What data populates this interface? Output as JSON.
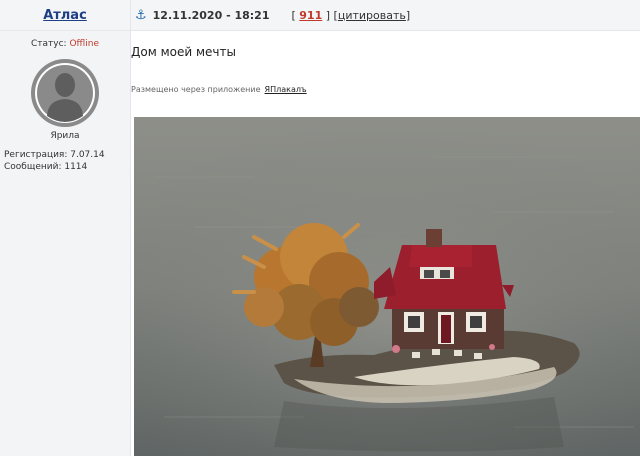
{
  "author": {
    "name": "Атлас"
  },
  "status": {
    "label": "Статус:",
    "value": "Offline"
  },
  "rank": "Ярила",
  "registration": "Регистрация: 7.07.14",
  "posts_count": "Сообщений: 1114",
  "post": {
    "anchor_icon": "anchor-icon",
    "datetime": "12.11.2020 - 18:21",
    "rating_open": "[",
    "rating": "911",
    "rating_close": "]",
    "quote_open": "[",
    "quote_label": "цитировать",
    "quote_close": "]",
    "title": "Дом моей мечты",
    "posted_via": "Размещено через приложение",
    "app_name": "ЯПлакалъ"
  },
  "colors": {
    "author": "#1f3f84",
    "offline": "#c0392b",
    "rating": "#c0392b",
    "anchor": "#2a6cb0"
  }
}
